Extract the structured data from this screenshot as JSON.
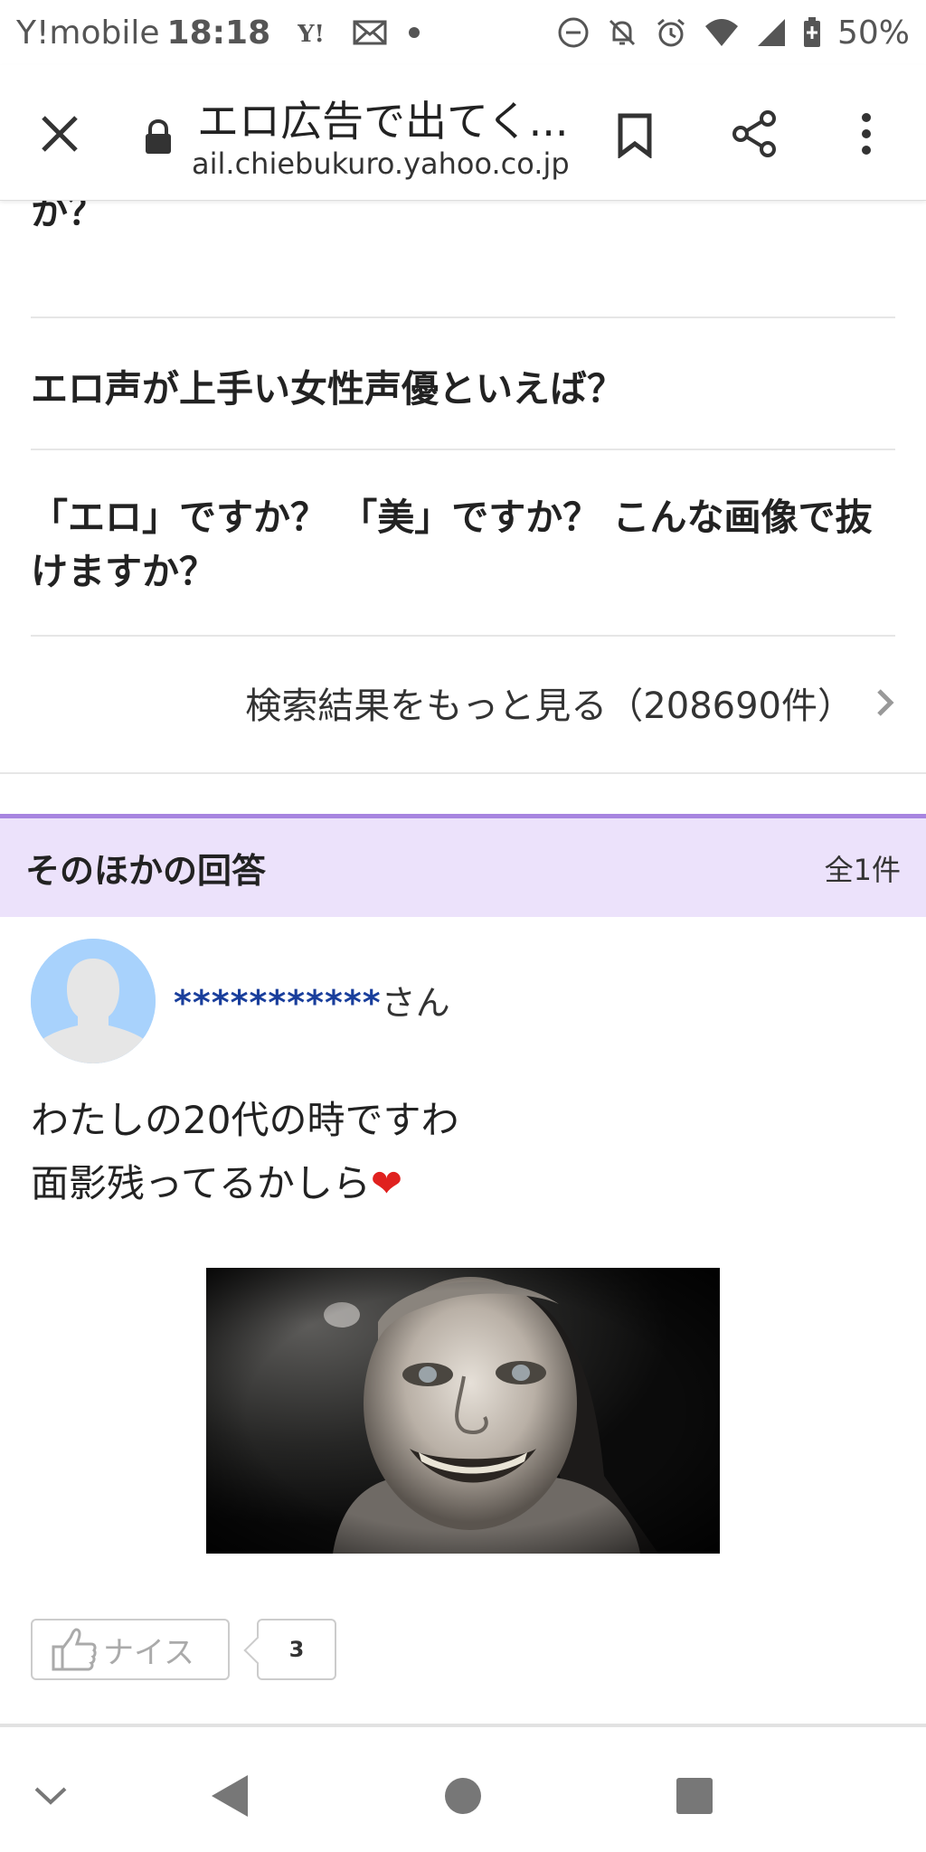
{
  "status_bar": {
    "carrier": "Y!mobile",
    "time": "18:18",
    "battery": "50%"
  },
  "browser": {
    "page_title": "エロ広告で出てく...",
    "url": "ail.chiebukuro.yahoo.co.jp"
  },
  "related_questions": [
    "か？",
    "エロ声が上手い女性声優といえば？",
    "「エロ」ですか？ 「美」ですか？ こんな画像で抜けますか？"
  ],
  "more_results": "検索結果をもっと見る（208690件）",
  "other_answers": {
    "title": "そのほかの回答",
    "count": "全1件"
  },
  "answer": {
    "username_masked": "***********",
    "username_suffix": "さん",
    "line1": "わたしの20代の時ですわ",
    "line2": "面影残ってるかしら",
    "heart": "❤",
    "nice_label": "ナイス",
    "nice_count": "3"
  },
  "colors": {
    "header_bg": "#ece2fb",
    "header_accent": "#a784e0",
    "username": "#1a3f9c",
    "avatar_bg": "#a8d2fc"
  }
}
